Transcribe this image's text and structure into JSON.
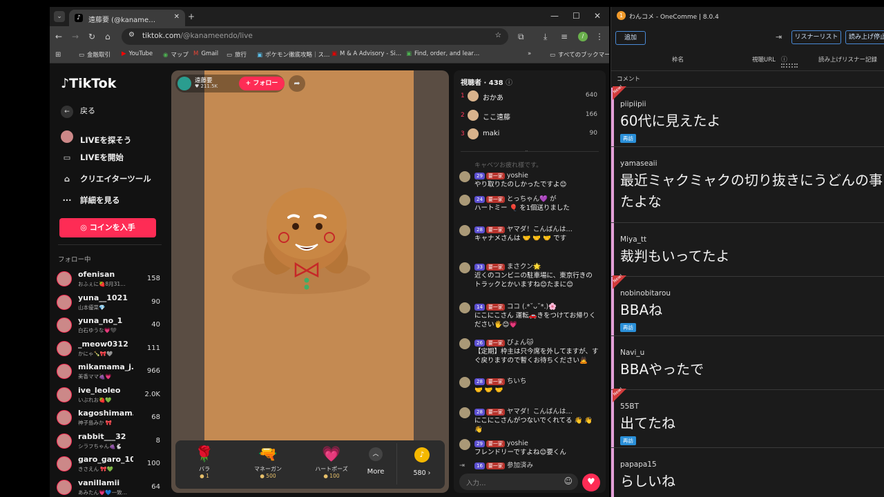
{
  "browser": {
    "tab_title": "遠藤要 (@kaname…",
    "url_host": "tiktok.com",
    "url_path": "/@kanameendo/live",
    "bookmarks": [
      {
        "icon": "folder-icon",
        "label": "金融取引"
      },
      {
        "icon": "youtube-icon",
        "label": "YouTube"
      },
      {
        "icon": "maps-icon",
        "label": "マップ"
      },
      {
        "icon": "gmail-icon",
        "label": "Gmail"
      },
      {
        "icon": "folder-icon",
        "label": "旅行"
      },
      {
        "icon": "bookmark-icon",
        "label": "ポケモン徹底攻略｜ス…"
      },
      {
        "icon": "bookmark-icon",
        "label": "M & A Advisory - Si…"
      },
      {
        "icon": "bookmark-icon",
        "label": "Find, order, and lear…"
      }
    ],
    "all_bookmarks": "すべてのブックマーク"
  },
  "tiktok": {
    "logo": "TikTok",
    "back": "戻る",
    "nav": [
      "LIVEを探そう",
      "LIVEを開始",
      "クリエイターツール",
      "詳細を見る"
    ],
    "coin_button": "コインを入手",
    "following_header": "フォロー中",
    "following": [
      {
        "name": "ofenisan",
        "sub": "おふぇに🍓8月31…",
        "count": "158"
      },
      {
        "name": "yuna__1021",
        "sub": "山本優菜💎",
        "count": "90"
      },
      {
        "name": "yuna_no_1",
        "sub": "白石ゆうな💗🖤",
        "count": "40"
      },
      {
        "name": "_meow0312",
        "sub": "かにゃ🍾🎀🩶",
        "count": "111"
      },
      {
        "name": "mikamama_j…",
        "sub": "美香ママ🍇💗",
        "count": "966"
      },
      {
        "name": "ive_leoleo",
        "sub": "いぶれお🍓💚",
        "count": "2.0K"
      },
      {
        "name": "kagoshimam…",
        "sub": "神子島みか 🎀",
        "count": "68"
      },
      {
        "name": "rabbit___32",
        "sub": "シラフちゃん🍇🐇",
        "count": "8"
      },
      {
        "name": "garo_garo_104",
        "sub": "きさえん 🎀💚",
        "count": "100"
      },
      {
        "name": "vanillamii",
        "sub": "あみたん💗💙一致…",
        "count": "64"
      }
    ],
    "host": {
      "name": "遠藤要",
      "likes": "♥ 211.5K",
      "follow": "+ フォロー"
    },
    "gifts": [
      {
        "icon": "🌹",
        "name": "バラ",
        "price": "1"
      },
      {
        "icon": "🔫",
        "name": "マネーガン",
        "price": "500"
      },
      {
        "icon": "💗",
        "name": "ハートポーズ",
        "price": "100"
      }
    ],
    "more": "More",
    "balance": "580 ›",
    "viewers_label": "視聴者 · 438",
    "ranking": [
      {
        "rank": "1",
        "name": "おかあ",
        "score": "640"
      },
      {
        "rank": "2",
        "name": "ここ遠藤",
        "score": "166"
      },
      {
        "rank": "3",
        "name": "maki",
        "score": "90"
      }
    ],
    "chat_faded": "キャベツお疲れ様です。",
    "messages": [
      {
        "lv": "29",
        "fan": "要一家",
        "nick": "yoshie",
        "text": "やり取りたのしかったですよ😊"
      },
      {
        "lv": "24",
        "fan": "要一家",
        "nick": "とっちゃん💜 が",
        "text": "ハートミー 🎈 を1個送りました"
      },
      {
        "lv": "28",
        "fan": "要一家",
        "nick": "ヤマダ！こんばんは…",
        "text": "キャナメさんは 🤝 🤝 🤝 です"
      },
      {
        "lv": "33",
        "fan": "要一家",
        "nick": "まさクン🌟",
        "text": "近くのコンビニの駐車場に、東京行きのトラックとかいますね😊たまに😊"
      },
      {
        "lv": "14",
        "fan": "要一家",
        "nick": "ココ (.*˘ᴗ˘*.)🌸",
        "text": "にこにこさん 運転🚗きをつけてお帰りください🖐😊💗"
      },
      {
        "lv": "26",
        "fan": "要一家",
        "nick": "ぴょん🐱",
        "text": "【定期】枠主は只今席を外してますが、すぐ戻りますので暫くお待ちください🙇"
      },
      {
        "lv": "28",
        "fan": "要一家",
        "nick": "ちいち",
        "text": "🤝 🤝 🤝"
      },
      {
        "lv": "28",
        "fan": "要一家",
        "nick": "ヤマダ！こんばんは…",
        "text": "にこにこさんがつないでくれてる 👋 👋 👋"
      },
      {
        "lv": "29",
        "fan": "要一家",
        "nick": "yoshie",
        "text": "フレンドリーですよね😊要くん"
      }
    ],
    "join": {
      "lv": "16",
      "fan": "要一家",
      "text": "参加済み"
    },
    "chat_placeholder": "入力…"
  },
  "onecomme": {
    "title": "わんコメ - OneComme | 8.0.4",
    "add": "追加",
    "listener_list": "リスナーリスト",
    "read_stop": "読み上げ停止",
    "cols": [
      "枠名",
      "視聴URL",
      "読み上げリスナー記録"
    ],
    "comment_header": "コメント",
    "comments": [
      {
        "user": "piipiipii",
        "text": "60代に見えたよ",
        "revisit": "再訪",
        "new": true
      },
      {
        "user": "yamaseaii",
        "text": "最近ミャクミャクの切り抜きにうどんの事",
        "text2": "たよな",
        "revisit": "",
        "new": false
      },
      {
        "user": "Miya_tt",
        "text": "裁判もいってたよ",
        "revisit": "",
        "new": false
      },
      {
        "user": "nobinobitarou",
        "text": "BBAね",
        "revisit": "再訪",
        "new": true
      },
      {
        "user": "Navi_u",
        "text": "BBAやったで",
        "revisit": "",
        "new": false
      },
      {
        "user": "55BT",
        "text": "出てたね",
        "revisit": "再訪",
        "new": true
      },
      {
        "user": "papapa15",
        "text": "らしいね",
        "revisit": "",
        "new": false
      }
    ],
    "new_label": "New!"
  }
}
